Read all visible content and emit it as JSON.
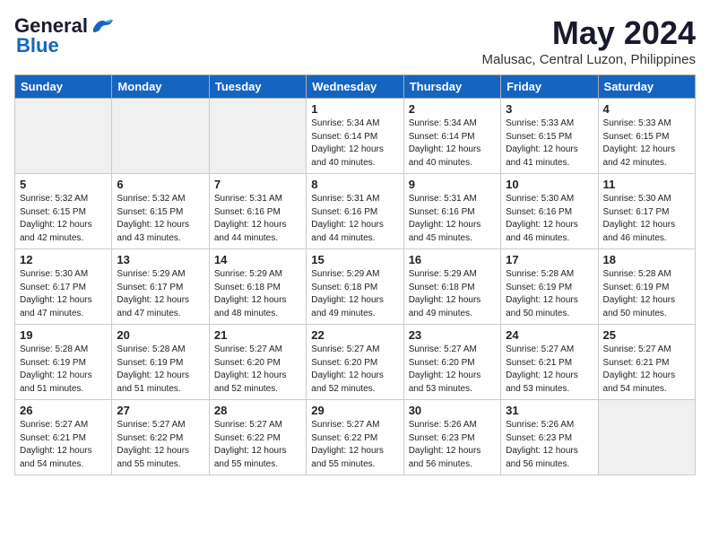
{
  "logo": {
    "general": "General",
    "blue": "Blue"
  },
  "title": "May 2024",
  "location": "Malusac, Central Luzon, Philippines",
  "days_of_week": [
    "Sunday",
    "Monday",
    "Tuesday",
    "Wednesday",
    "Thursday",
    "Friday",
    "Saturday"
  ],
  "weeks": [
    [
      {
        "day": "",
        "info": ""
      },
      {
        "day": "",
        "info": ""
      },
      {
        "day": "",
        "info": ""
      },
      {
        "day": "1",
        "info": "Sunrise: 5:34 AM\nSunset: 6:14 PM\nDaylight: 12 hours\nand 40 minutes."
      },
      {
        "day": "2",
        "info": "Sunrise: 5:34 AM\nSunset: 6:14 PM\nDaylight: 12 hours\nand 40 minutes."
      },
      {
        "day": "3",
        "info": "Sunrise: 5:33 AM\nSunset: 6:15 PM\nDaylight: 12 hours\nand 41 minutes."
      },
      {
        "day": "4",
        "info": "Sunrise: 5:33 AM\nSunset: 6:15 PM\nDaylight: 12 hours\nand 42 minutes."
      }
    ],
    [
      {
        "day": "5",
        "info": "Sunrise: 5:32 AM\nSunset: 6:15 PM\nDaylight: 12 hours\nand 42 minutes."
      },
      {
        "day": "6",
        "info": "Sunrise: 5:32 AM\nSunset: 6:15 PM\nDaylight: 12 hours\nand 43 minutes."
      },
      {
        "day": "7",
        "info": "Sunrise: 5:31 AM\nSunset: 6:16 PM\nDaylight: 12 hours\nand 44 minutes."
      },
      {
        "day": "8",
        "info": "Sunrise: 5:31 AM\nSunset: 6:16 PM\nDaylight: 12 hours\nand 44 minutes."
      },
      {
        "day": "9",
        "info": "Sunrise: 5:31 AM\nSunset: 6:16 PM\nDaylight: 12 hours\nand 45 minutes."
      },
      {
        "day": "10",
        "info": "Sunrise: 5:30 AM\nSunset: 6:16 PM\nDaylight: 12 hours\nand 46 minutes."
      },
      {
        "day": "11",
        "info": "Sunrise: 5:30 AM\nSunset: 6:17 PM\nDaylight: 12 hours\nand 46 minutes."
      }
    ],
    [
      {
        "day": "12",
        "info": "Sunrise: 5:30 AM\nSunset: 6:17 PM\nDaylight: 12 hours\nand 47 minutes."
      },
      {
        "day": "13",
        "info": "Sunrise: 5:29 AM\nSunset: 6:17 PM\nDaylight: 12 hours\nand 47 minutes."
      },
      {
        "day": "14",
        "info": "Sunrise: 5:29 AM\nSunset: 6:18 PM\nDaylight: 12 hours\nand 48 minutes."
      },
      {
        "day": "15",
        "info": "Sunrise: 5:29 AM\nSunset: 6:18 PM\nDaylight: 12 hours\nand 49 minutes."
      },
      {
        "day": "16",
        "info": "Sunrise: 5:29 AM\nSunset: 6:18 PM\nDaylight: 12 hours\nand 49 minutes."
      },
      {
        "day": "17",
        "info": "Sunrise: 5:28 AM\nSunset: 6:19 PM\nDaylight: 12 hours\nand 50 minutes."
      },
      {
        "day": "18",
        "info": "Sunrise: 5:28 AM\nSunset: 6:19 PM\nDaylight: 12 hours\nand 50 minutes."
      }
    ],
    [
      {
        "day": "19",
        "info": "Sunrise: 5:28 AM\nSunset: 6:19 PM\nDaylight: 12 hours\nand 51 minutes."
      },
      {
        "day": "20",
        "info": "Sunrise: 5:28 AM\nSunset: 6:19 PM\nDaylight: 12 hours\nand 51 minutes."
      },
      {
        "day": "21",
        "info": "Sunrise: 5:27 AM\nSunset: 6:20 PM\nDaylight: 12 hours\nand 52 minutes."
      },
      {
        "day": "22",
        "info": "Sunrise: 5:27 AM\nSunset: 6:20 PM\nDaylight: 12 hours\nand 52 minutes."
      },
      {
        "day": "23",
        "info": "Sunrise: 5:27 AM\nSunset: 6:20 PM\nDaylight: 12 hours\nand 53 minutes."
      },
      {
        "day": "24",
        "info": "Sunrise: 5:27 AM\nSunset: 6:21 PM\nDaylight: 12 hours\nand 53 minutes."
      },
      {
        "day": "25",
        "info": "Sunrise: 5:27 AM\nSunset: 6:21 PM\nDaylight: 12 hours\nand 54 minutes."
      }
    ],
    [
      {
        "day": "26",
        "info": "Sunrise: 5:27 AM\nSunset: 6:21 PM\nDaylight: 12 hours\nand 54 minutes."
      },
      {
        "day": "27",
        "info": "Sunrise: 5:27 AM\nSunset: 6:22 PM\nDaylight: 12 hours\nand 55 minutes."
      },
      {
        "day": "28",
        "info": "Sunrise: 5:27 AM\nSunset: 6:22 PM\nDaylight: 12 hours\nand 55 minutes."
      },
      {
        "day": "29",
        "info": "Sunrise: 5:27 AM\nSunset: 6:22 PM\nDaylight: 12 hours\nand 55 minutes."
      },
      {
        "day": "30",
        "info": "Sunrise: 5:26 AM\nSunset: 6:23 PM\nDaylight: 12 hours\nand 56 minutes."
      },
      {
        "day": "31",
        "info": "Sunrise: 5:26 AM\nSunset: 6:23 PM\nDaylight: 12 hours\nand 56 minutes."
      },
      {
        "day": "",
        "info": ""
      }
    ]
  ]
}
